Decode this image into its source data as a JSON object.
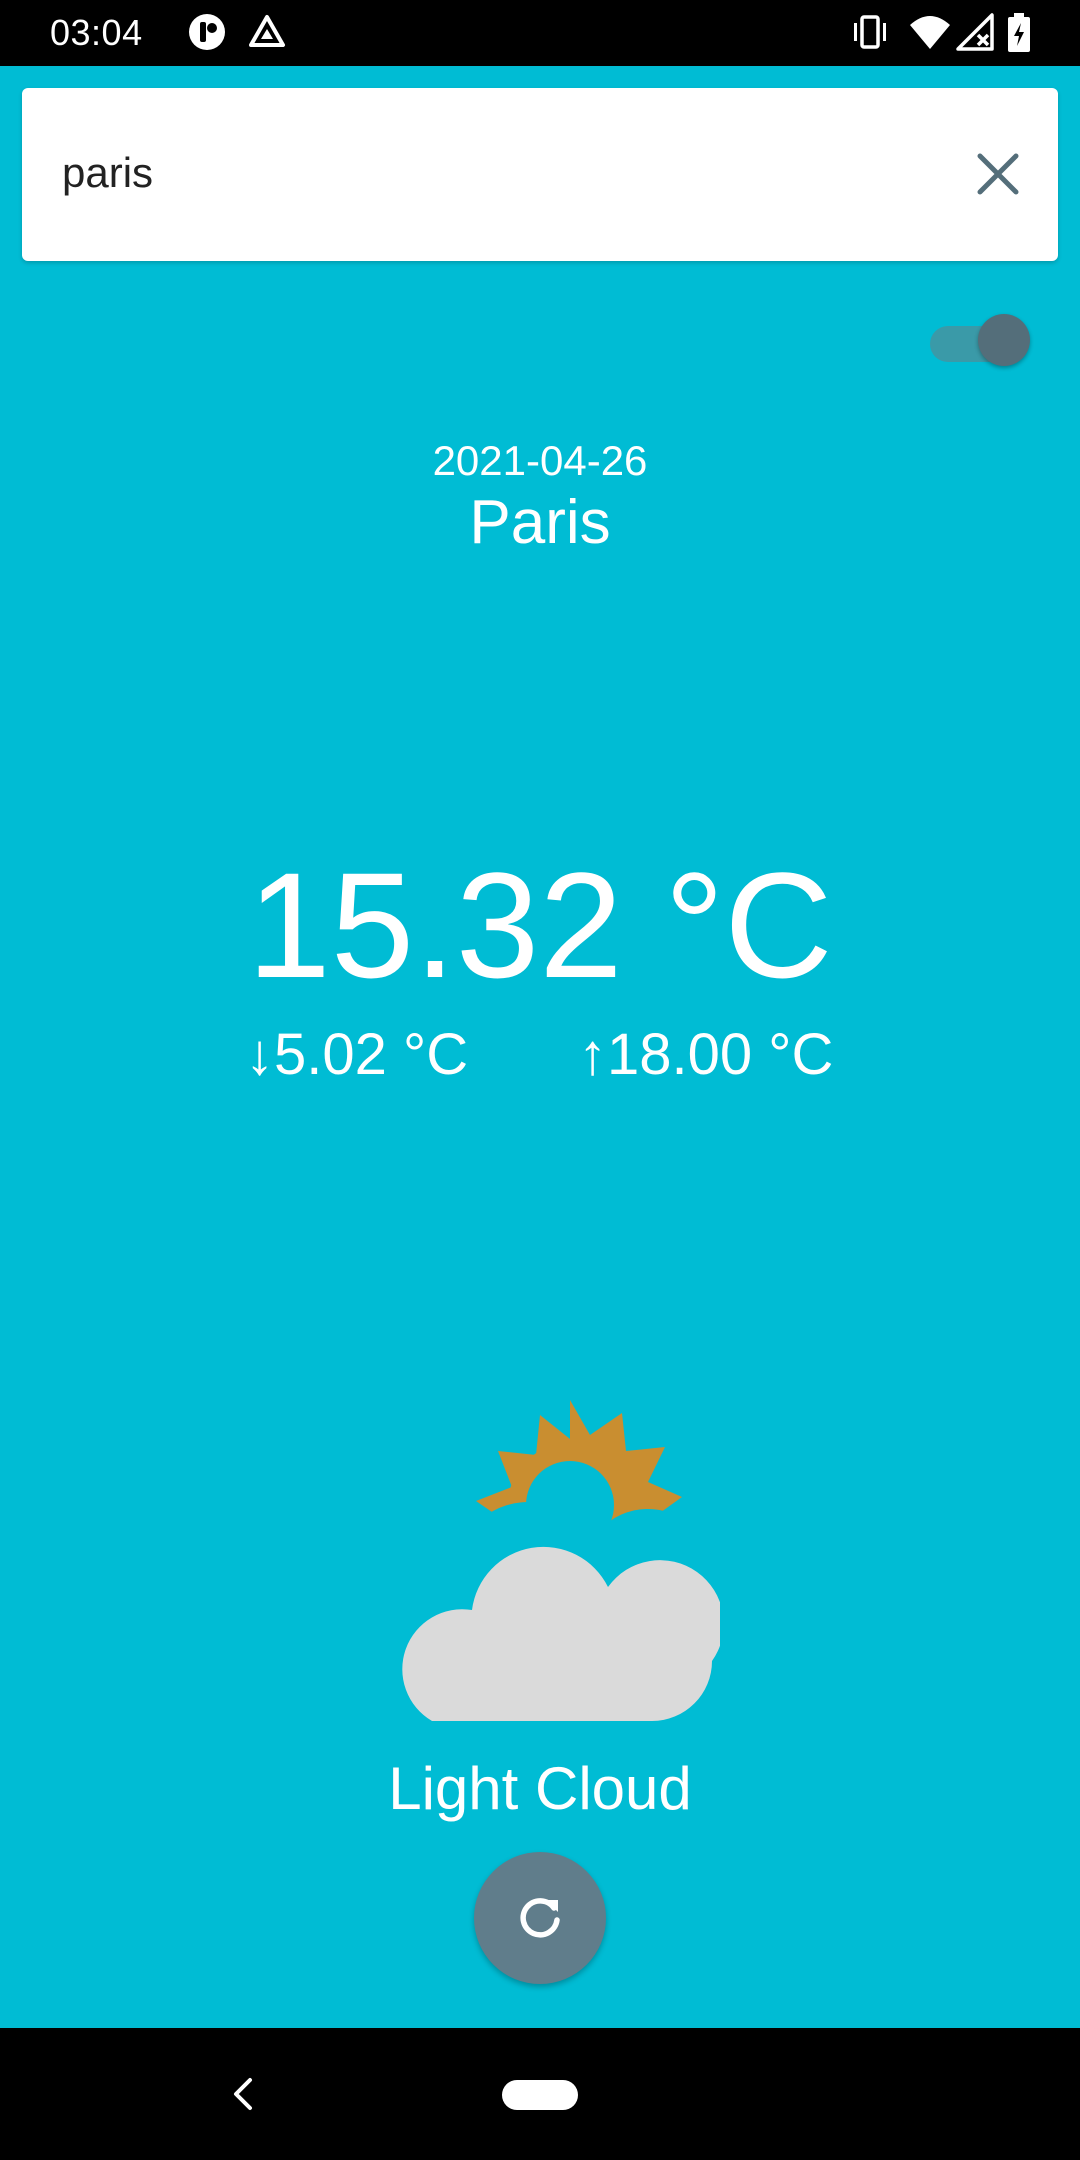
{
  "status_bar": {
    "time": "03:04",
    "icons": [
      "app-indicator-icon",
      "drive-icon",
      "vibrate-icon",
      "wifi-icon",
      "signal-icon",
      "battery-icon"
    ]
  },
  "search": {
    "value": "paris",
    "placeholder": "",
    "clear_icon": "close-icon"
  },
  "toggle": {
    "state": "on"
  },
  "weather": {
    "date": "2021-04-26",
    "city": "Paris",
    "temperature": "15.32 °C",
    "min_temp": "↓5.02 °C",
    "max_temp": "↑18.00 °C",
    "condition": "Light Cloud",
    "icon": "light-cloud-icon"
  },
  "colors": {
    "background": "#00BCD4",
    "fab": "#607D8B",
    "sun": "#C98E30",
    "cloud": "#DADADA"
  },
  "nav_bar": {
    "icons": [
      "back-icon",
      "home-pill"
    ]
  }
}
